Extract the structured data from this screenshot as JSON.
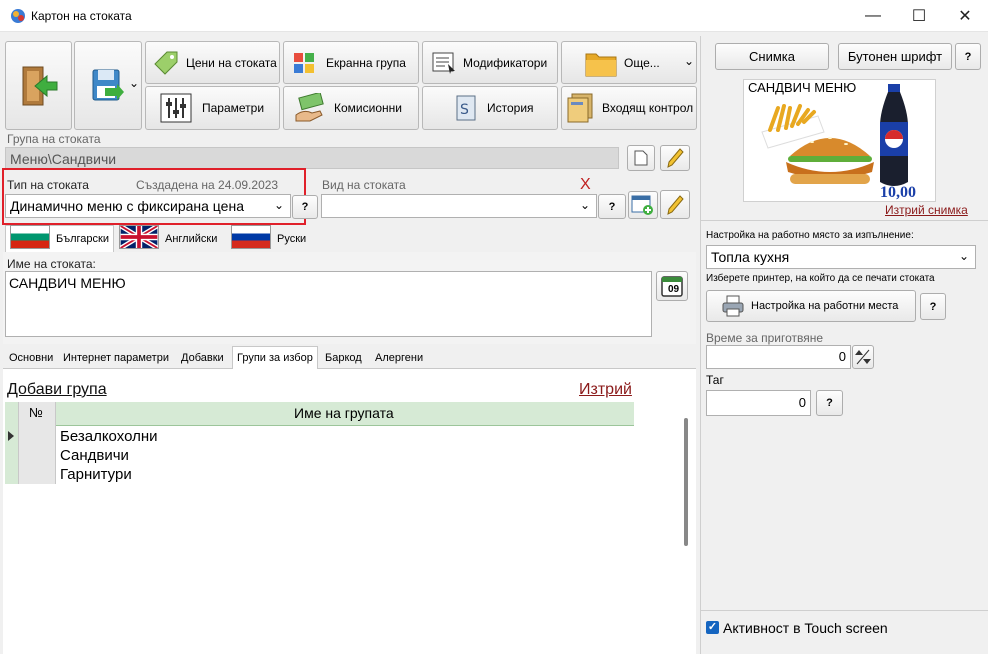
{
  "window": {
    "title": "Картон на стоката",
    "minimize": "—",
    "maximize": "☐",
    "close": "✕"
  },
  "toolbar": {
    "prices": "Цени на стоката",
    "screen_group": "Екранна група",
    "modifiers": "Модификатори",
    "more": "Още...",
    "params": "Параметри",
    "commission": "Комисионни",
    "history": "История",
    "incoming_control": "Входящ контрол",
    "dropdown_arrow": "⌄"
  },
  "group": {
    "label": "Група на стоката",
    "value": "Меню\\Сандвичи"
  },
  "type": {
    "label": "Тип на стоката",
    "created": "Създадена на 24.09.2023",
    "value": "Динамично меню с фиксирана цена",
    "help": "?",
    "kind_label": "Вид на стоката",
    "kind_value": "",
    "clear": "X",
    "highlight_color": "#e0202a"
  },
  "languages": [
    {
      "label": "Български",
      "flag": "bulgaria-flag"
    },
    {
      "label": "Английски",
      "flag": "uk-flag"
    },
    {
      "label": "Руски",
      "flag": "russia-flag"
    }
  ],
  "name": {
    "label": "Име на стоката:",
    "value": "САНДВИЧ МЕНЮ",
    "calendar_day": "09"
  },
  "tabs": [
    "Основни",
    "Интернет параметри",
    "Добавки",
    "Групи за избор",
    "Баркод",
    "Алергени"
  ],
  "groups_panel": {
    "add": "Добави група",
    "delete": "Изтрий",
    "col_no": "№",
    "col_name": "Име на групата",
    "rows": [
      "Безалкохолни",
      "Сандвичи",
      "Гарнитури"
    ]
  },
  "right": {
    "photo_button": "Снимка",
    "font_button": "Бутонен шрифт",
    "help": "?",
    "image_caption": "САНДВИЧ МЕНЮ",
    "image_price": "10,00",
    "delete_image": "Изтрий снимка",
    "workplace_label": "Настройка на работно място за изпълнение:",
    "workplace_value": "Топла кухня",
    "printer_hint": "Изберете принтер, на който да се печати стоката",
    "workplace_settings": "Настройка на работни места",
    "prep_time_label": "Време за приготвяне",
    "prep_time_value": "0",
    "tag_label": "Таг",
    "tag_value": "0",
    "touch_label": "Активност в Touch screen",
    "touch_checked": "✓"
  },
  "colors": {
    "link_red": "#8b1a1a",
    "grid_header": "#d6ead5",
    "price_blue": "#1a3fa8"
  }
}
